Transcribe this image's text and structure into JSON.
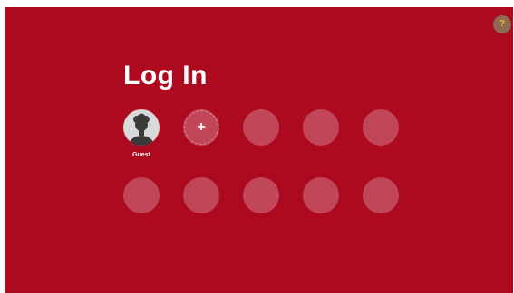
{
  "colors": {
    "background": "#ad0a20",
    "slot": "rgba(255,255,255,0.25)",
    "help_badge": "#8e6a55",
    "help_glyph": "#e6c21c"
  },
  "header": {
    "title": "Log In",
    "help_label": "?"
  },
  "profiles": {
    "guest": {
      "name": "Guest",
      "icon": "person-silhouette-icon"
    },
    "add_label": "+",
    "empty_slots_row1": 3,
    "empty_slots_row2": 5
  }
}
